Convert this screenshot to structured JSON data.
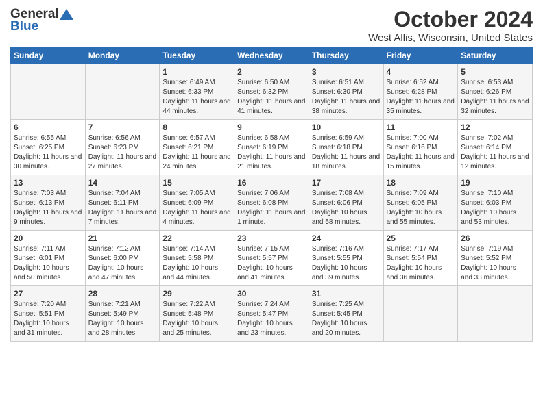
{
  "logo": {
    "general": "General",
    "blue": "Blue"
  },
  "title": "October 2024",
  "location": "West Allis, Wisconsin, United States",
  "headers": [
    "Sunday",
    "Monday",
    "Tuesday",
    "Wednesday",
    "Thursday",
    "Friday",
    "Saturday"
  ],
  "weeks": [
    [
      {
        "day": "",
        "info": ""
      },
      {
        "day": "",
        "info": ""
      },
      {
        "day": "1",
        "info": "Sunrise: 6:49 AM\nSunset: 6:33 PM\nDaylight: 11 hours and 44 minutes."
      },
      {
        "day": "2",
        "info": "Sunrise: 6:50 AM\nSunset: 6:32 PM\nDaylight: 11 hours and 41 minutes."
      },
      {
        "day": "3",
        "info": "Sunrise: 6:51 AM\nSunset: 6:30 PM\nDaylight: 11 hours and 38 minutes."
      },
      {
        "day": "4",
        "info": "Sunrise: 6:52 AM\nSunset: 6:28 PM\nDaylight: 11 hours and 35 minutes."
      },
      {
        "day": "5",
        "info": "Sunrise: 6:53 AM\nSunset: 6:26 PM\nDaylight: 11 hours and 32 minutes."
      }
    ],
    [
      {
        "day": "6",
        "info": "Sunrise: 6:55 AM\nSunset: 6:25 PM\nDaylight: 11 hours and 30 minutes."
      },
      {
        "day": "7",
        "info": "Sunrise: 6:56 AM\nSunset: 6:23 PM\nDaylight: 11 hours and 27 minutes."
      },
      {
        "day": "8",
        "info": "Sunrise: 6:57 AM\nSunset: 6:21 PM\nDaylight: 11 hours and 24 minutes."
      },
      {
        "day": "9",
        "info": "Sunrise: 6:58 AM\nSunset: 6:19 PM\nDaylight: 11 hours and 21 minutes."
      },
      {
        "day": "10",
        "info": "Sunrise: 6:59 AM\nSunset: 6:18 PM\nDaylight: 11 hours and 18 minutes."
      },
      {
        "day": "11",
        "info": "Sunrise: 7:00 AM\nSunset: 6:16 PM\nDaylight: 11 hours and 15 minutes."
      },
      {
        "day": "12",
        "info": "Sunrise: 7:02 AM\nSunset: 6:14 PM\nDaylight: 11 hours and 12 minutes."
      }
    ],
    [
      {
        "day": "13",
        "info": "Sunrise: 7:03 AM\nSunset: 6:13 PM\nDaylight: 11 hours and 9 minutes."
      },
      {
        "day": "14",
        "info": "Sunrise: 7:04 AM\nSunset: 6:11 PM\nDaylight: 11 hours and 7 minutes."
      },
      {
        "day": "15",
        "info": "Sunrise: 7:05 AM\nSunset: 6:09 PM\nDaylight: 11 hours and 4 minutes."
      },
      {
        "day": "16",
        "info": "Sunrise: 7:06 AM\nSunset: 6:08 PM\nDaylight: 11 hours and 1 minute."
      },
      {
        "day": "17",
        "info": "Sunrise: 7:08 AM\nSunset: 6:06 PM\nDaylight: 10 hours and 58 minutes."
      },
      {
        "day": "18",
        "info": "Sunrise: 7:09 AM\nSunset: 6:05 PM\nDaylight: 10 hours and 55 minutes."
      },
      {
        "day": "19",
        "info": "Sunrise: 7:10 AM\nSunset: 6:03 PM\nDaylight: 10 hours and 53 minutes."
      }
    ],
    [
      {
        "day": "20",
        "info": "Sunrise: 7:11 AM\nSunset: 6:01 PM\nDaylight: 10 hours and 50 minutes."
      },
      {
        "day": "21",
        "info": "Sunrise: 7:12 AM\nSunset: 6:00 PM\nDaylight: 10 hours and 47 minutes."
      },
      {
        "day": "22",
        "info": "Sunrise: 7:14 AM\nSunset: 5:58 PM\nDaylight: 10 hours and 44 minutes."
      },
      {
        "day": "23",
        "info": "Sunrise: 7:15 AM\nSunset: 5:57 PM\nDaylight: 10 hours and 41 minutes."
      },
      {
        "day": "24",
        "info": "Sunrise: 7:16 AM\nSunset: 5:55 PM\nDaylight: 10 hours and 39 minutes."
      },
      {
        "day": "25",
        "info": "Sunrise: 7:17 AM\nSunset: 5:54 PM\nDaylight: 10 hours and 36 minutes."
      },
      {
        "day": "26",
        "info": "Sunrise: 7:19 AM\nSunset: 5:52 PM\nDaylight: 10 hours and 33 minutes."
      }
    ],
    [
      {
        "day": "27",
        "info": "Sunrise: 7:20 AM\nSunset: 5:51 PM\nDaylight: 10 hours and 31 minutes."
      },
      {
        "day": "28",
        "info": "Sunrise: 7:21 AM\nSunset: 5:49 PM\nDaylight: 10 hours and 28 minutes."
      },
      {
        "day": "29",
        "info": "Sunrise: 7:22 AM\nSunset: 5:48 PM\nDaylight: 10 hours and 25 minutes."
      },
      {
        "day": "30",
        "info": "Sunrise: 7:24 AM\nSunset: 5:47 PM\nDaylight: 10 hours and 23 minutes."
      },
      {
        "day": "31",
        "info": "Sunrise: 7:25 AM\nSunset: 5:45 PM\nDaylight: 10 hours and 20 minutes."
      },
      {
        "day": "",
        "info": ""
      },
      {
        "day": "",
        "info": ""
      }
    ]
  ]
}
